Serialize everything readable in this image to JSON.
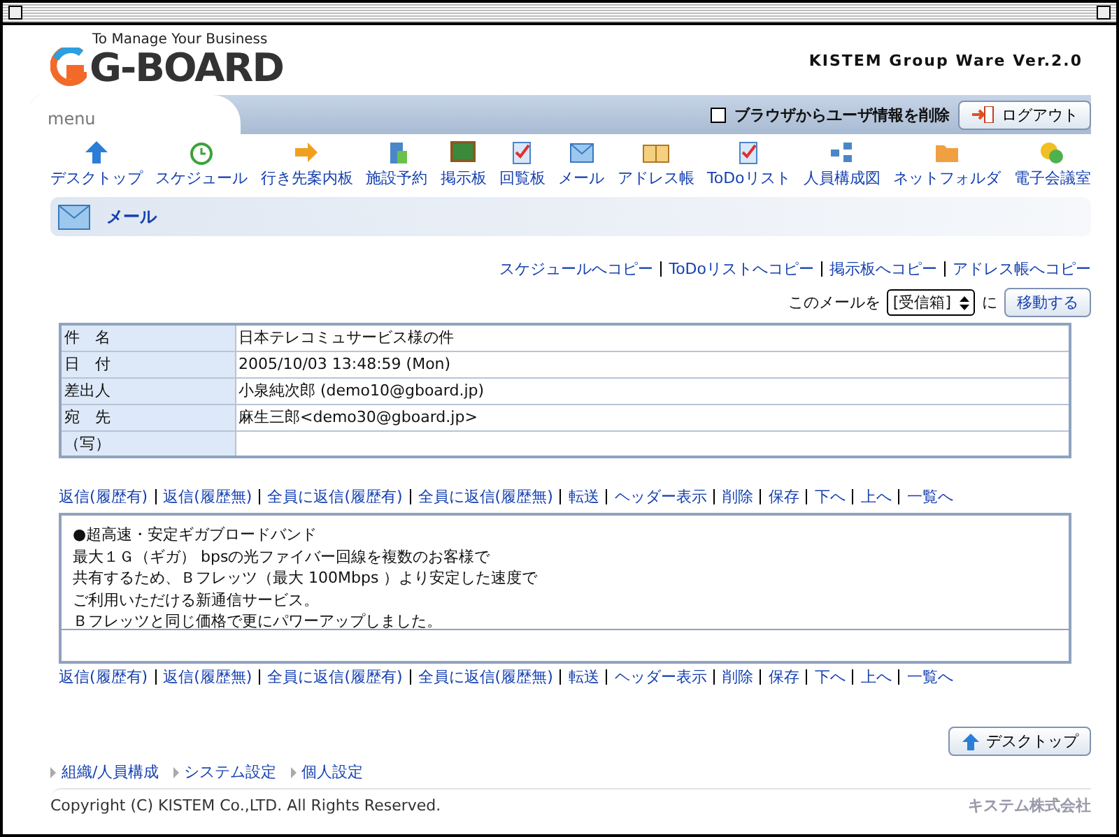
{
  "logo": {
    "tagline": "To Manage Your Business",
    "name": "G-BOARD"
  },
  "product": "KISTEM Group Ware Ver.2.0",
  "menu_bar": {
    "label": "menu",
    "clear_option": {
      "label": "ブラウザからユーザ情報を削除",
      "checked": false
    },
    "logout": "ログアウト"
  },
  "nav": [
    "デスクトップ",
    "スケジュール",
    "行き先案内板",
    "施設予約",
    "掲示板",
    "回覧板",
    "メール",
    "アドレス帳",
    "ToDoリスト",
    "人員構成図",
    "ネットフォルダ",
    "電子会議室"
  ],
  "page_title": "メール",
  "copy_links": [
    "スケジュールへコピー",
    "ToDoリストへコピー",
    "掲示板へコピー",
    "アドレス帳へコピー"
  ],
  "move": {
    "prefix": "このメールを",
    "folder": "[受信箱]",
    "suffix": "に",
    "button": "移動する"
  },
  "header": [
    {
      "label": "件　名",
      "value": "日本テレコミュサービス様の件"
    },
    {
      "label": "日　付",
      "value": "2005/10/03 13:48:59 (Mon)"
    },
    {
      "label": "差出人",
      "value": "小泉純次郎 (demo10@gboard.jp)"
    },
    {
      "label": "宛　先",
      "value": "麻生三郎<demo30@gboard.jp>"
    },
    {
      "label": "（写）"
    }
  ],
  "actions_top": [
    "返信(履歴有)",
    "返信(履歴無)",
    "全員に返信(履歴有)",
    "全員に返信(履歴無)",
    "転送",
    "ヘッダー表示",
    "削除",
    "保存",
    "下へ",
    "上へ",
    "一覧へ"
  ],
  "body": [
    "●超高速・安定ギガブロードバンド",
    "最大１Ｇ（ギガ） bpsの光ファイバー回線を複数のお客様で",
    "共有するため、Ｂフレッツ（最大 100Mbps ）より安定した速度で",
    "ご利用いただける新通信サービス。",
    "Ｂフレッツと同じ価格で更にパワーアップしました。"
  ],
  "actions_bottom": [
    "返信(履歴有)",
    "返信(履歴無)",
    "全員に返信(履歴有)",
    "全員に返信(履歴無)",
    "転送",
    "ヘッダー表示",
    "削除",
    "保存",
    "下へ",
    "上へ",
    "一覧へ"
  ],
  "desktop_button": "デスクトップ",
  "footer_links": [
    "組織/人員構成",
    "システム設定",
    "個人設定"
  ],
  "copyright": "Copyright (C) KISTEM Co.,LTD. All Rights Reserved.",
  "company": "キステム株式会社"
}
